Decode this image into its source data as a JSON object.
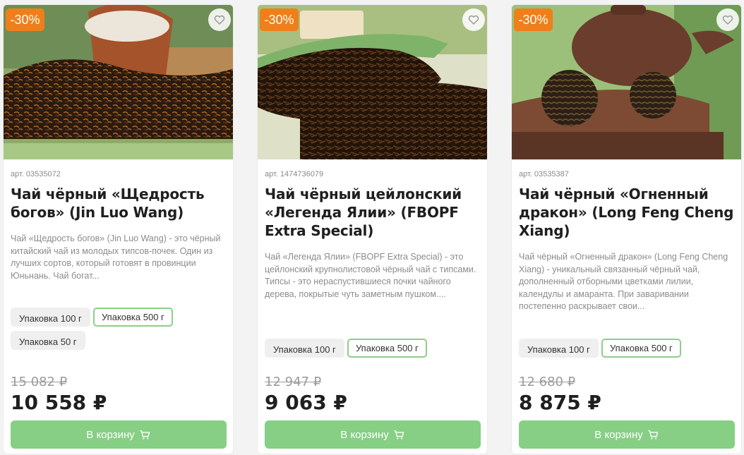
{
  "colors": {
    "badge": "#ef7f1a",
    "button": "#86cf84",
    "active_border": "#8ccf8a",
    "page_bg": "#f3f3f3"
  },
  "products": [
    {
      "badge": "-30%",
      "sku": "арт. 03535072",
      "title": "Чай чёрный «Щедрость богов» (Jin Luo Wang)",
      "description": "Чай «Щедрость богов» (Jin Luo Wang) - это чёрный китайский чай из молодых типсов-почек. Один из лучших сортов, который готовят в провинции Юньнань. Чай богат...",
      "packages": [
        "Упаковка 100 г",
        "Упаковка 500 г",
        "Упаковка 50 г"
      ],
      "selected_package": "Упаковка 500 г",
      "old_price": "15 082 ₽",
      "price": "10 558 ₽",
      "button": "В корзину",
      "favorite_icon": "heart-icon",
      "image_icon": "tea-leaves-image"
    },
    {
      "badge": "-30%",
      "sku": "арт. 1474736079",
      "title": "Чай чёрный цейлонский «Легенда Ялии» (FBOPF Extra Special)",
      "description": "Чай «Легенда Ялии» (FBOPF Extra Special) - это цейлонский крупнолистовой чёрный чай с типсами. Типсы - это нераспустившиеся почки чайного дерева, покрытые чуть заметным пушком....",
      "packages": [
        "Упаковка 100 г",
        "Упаковка 500 г"
      ],
      "selected_package": "Упаковка 500 г",
      "old_price": "12 947 ₽",
      "price": "9 063 ₽",
      "button": "В корзину",
      "favorite_icon": "heart-icon",
      "image_icon": "tea-leaves-image"
    },
    {
      "badge": "-30%",
      "sku": "арт. 03535387",
      "title": "Чай чёрный «Огненный дракон» (Long Feng Cheng Xiang)",
      "description": "Чай чёрный «Огненный дракон» (Long Feng Cheng Xiang) - уникальный связанный чёрный чай, дополненный отборными цветками лилии, календулы и амаранта. При заваривании постепенно раскрывает свои...",
      "packages": [
        "Упаковка 100 г",
        "Упаковка 500 г"
      ],
      "selected_package": "Упаковка 500 г",
      "old_price": "12 680 ₽",
      "price": "8 875 ₽",
      "button": "В корзину",
      "favorite_icon": "heart-icon",
      "image_icon": "tea-balls-image"
    }
  ]
}
